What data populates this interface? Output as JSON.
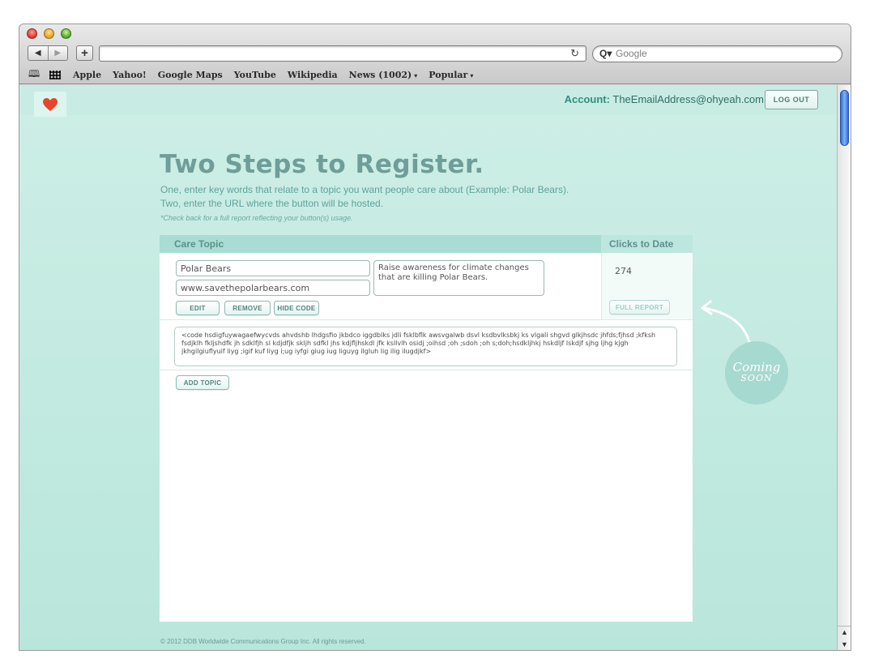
{
  "browser": {
    "back": "◀",
    "forward": "▶",
    "add": "+",
    "reload": "↻",
    "search_placeholder": "Google",
    "search_icon": "Q▾",
    "bookmarks": [
      {
        "label": "Apple"
      },
      {
        "label": "Yahoo!"
      },
      {
        "label": "Google Maps"
      },
      {
        "label": "YouTube"
      },
      {
        "label": "Wikipedia"
      },
      {
        "label": "News (1002)",
        "menu": "▾"
      },
      {
        "label": "Popular",
        "menu": "▾"
      }
    ]
  },
  "header": {
    "account_label": "Account:",
    "account_email": "TheEmailAddress@ohyeah.com",
    "logout": "LOG OUT"
  },
  "intro": {
    "title": "Two Steps to Register.",
    "line1": "One, enter key words that relate to a topic you want people care about (Example: Polar Bears).",
    "line2": "Two, enter the URL where the button will be hosted.",
    "note": "*Check back for a full report reflecting your button(s) usage."
  },
  "table": {
    "col_topic": "Care Topic",
    "col_clicks": "Clicks to Date",
    "row": {
      "topic": "Polar Bears",
      "url": "www.savethepolarbears.com",
      "description": "Raise awareness for climate changes that are killing Polar Bears.",
      "clicks": "274",
      "edit": "EDIT",
      "remove": "REMOVE",
      "hide_code": "HIDE CODE",
      "full_report": "FULL REPORT",
      "code": "<code hsdigfuywagaefwycvds ahvdshb lhdgsfio jkbdco iggdblks jdli fsklbflk awsvgalwb dsvl ksdbvlksbkj ks vlgali shgvd glkjhsdc jhfds;fjhsd ;kfksh fsdjklh fkljshdfk jh sdklfjh sl kdjdfjk skljh sdfkl jhs kdjfljhskdl jfk ksllvlh osidj ;oihsd ;oh ;sdoh ;oh s;doh;hsdkljhkj hskdljf lskdjf sjhg ljhg kjgh jkhgilgiuflyuif liyg ;igif kuf liyg i;ug iyfgi giug iug liguyg ilgluh lig ilig ilugdjkf>"
    },
    "add_topic": "ADD TOPIC"
  },
  "coming_soon": {
    "line1": "Coming",
    "line2": "SOON"
  },
  "footer": "© 2012 DDB Worldwide Communications Group Inc. All rights reserved.",
  "colors": {
    "accent": "#e8452c",
    "background": "#c8ece4",
    "heading": "#6f9d99"
  }
}
